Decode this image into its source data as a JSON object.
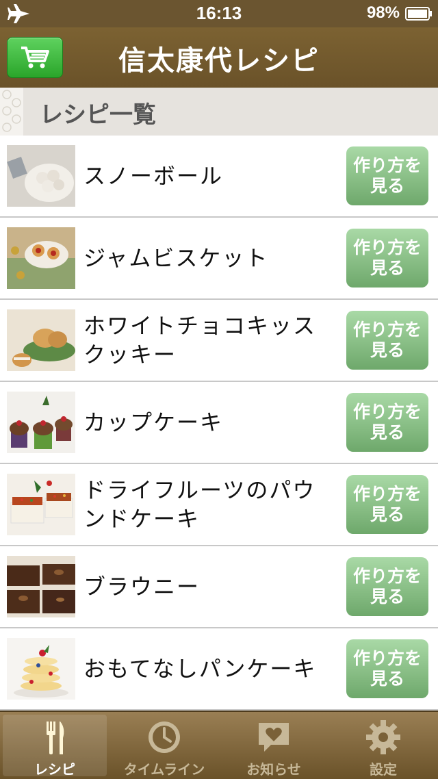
{
  "status_bar": {
    "time": "16:13",
    "battery": "98%"
  },
  "nav": {
    "title": "信太康代レシピ"
  },
  "section": {
    "title": "レシピ一覧"
  },
  "recipes": [
    {
      "title": "スノーボール",
      "button": "作り方を見る"
    },
    {
      "title": "ジャムビスケット",
      "button": "作り方を見る"
    },
    {
      "title": "ホワイトチョコキッスクッキー",
      "button": "作り方を見る"
    },
    {
      "title": "カップケーキ",
      "button": "作り方を見る"
    },
    {
      "title": "ドライフルーツのパウンドケーキ",
      "button": "作り方を見る"
    },
    {
      "title": "ブラウニー",
      "button": "作り方を見る"
    },
    {
      "title": "おもてなしパンケーキ",
      "button": "作り方を見る"
    }
  ],
  "tabs": [
    {
      "label": "レシピ",
      "icon": "fork-knife-icon",
      "active": true
    },
    {
      "label": "タイムライン",
      "icon": "clock-icon",
      "active": false
    },
    {
      "label": "お知らせ",
      "icon": "heart-message-icon",
      "active": false
    },
    {
      "label": "設定",
      "icon": "gear-icon",
      "active": false
    }
  ],
  "colors": {
    "nav": "#6b5530",
    "cart": "#3cb93c",
    "button": "#8cc389"
  }
}
